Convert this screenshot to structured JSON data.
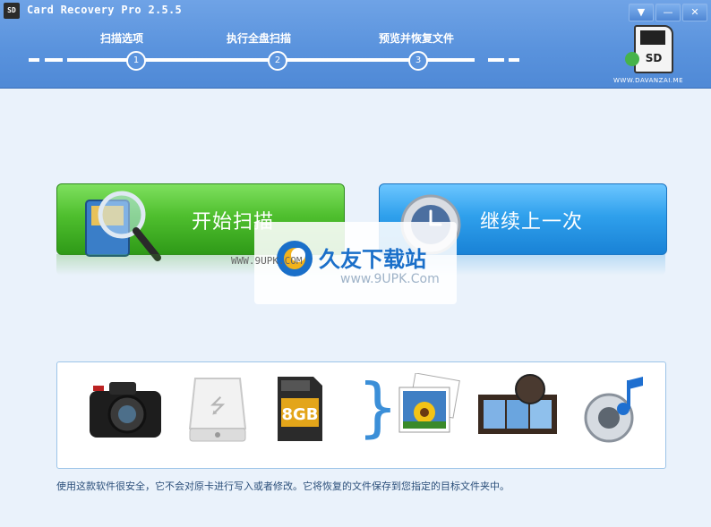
{
  "window": {
    "title": "Card Recovery Pro 2.5.5",
    "icon_text": "SD",
    "buttons": [
      "▼",
      "—",
      "✕"
    ]
  },
  "steps": [
    {
      "number": "1",
      "label": "扫描选项"
    },
    {
      "number": "2",
      "label": "执行全盘扫描"
    },
    {
      "number": "3",
      "label": "预览并恢复文件"
    }
  ],
  "brand": {
    "badge_text": "SD",
    "site": "WWW.DAVANZAI.ME"
  },
  "actions": {
    "start_scan": "开始扫描",
    "continue_last": "继续上一次"
  },
  "watermark": {
    "title": "久友下载站",
    "url_left": "WWW.9UPK.COM",
    "url_right": "www.9UPK.Com"
  },
  "media_types": {
    "sd_capacity": "8GB",
    "brace": "}"
  },
  "icons": {
    "camera": "camera-icon",
    "usb_drive": "usb-drive-icon",
    "sd_card": "sd-card-icon",
    "photos": "photos-icon",
    "video": "film-icon",
    "audio": "speaker-music-icon"
  },
  "footer_note": "使用这款软件很安全，它不会对原卡进行写入或者修改。它将恢复的文件保存到您指定的目标文件夹中。",
  "colors": {
    "header": "#5a93dd",
    "start_button": "#4fbf2e",
    "continue_button": "#2fa0ec",
    "note_text": "#2b4f7a"
  }
}
